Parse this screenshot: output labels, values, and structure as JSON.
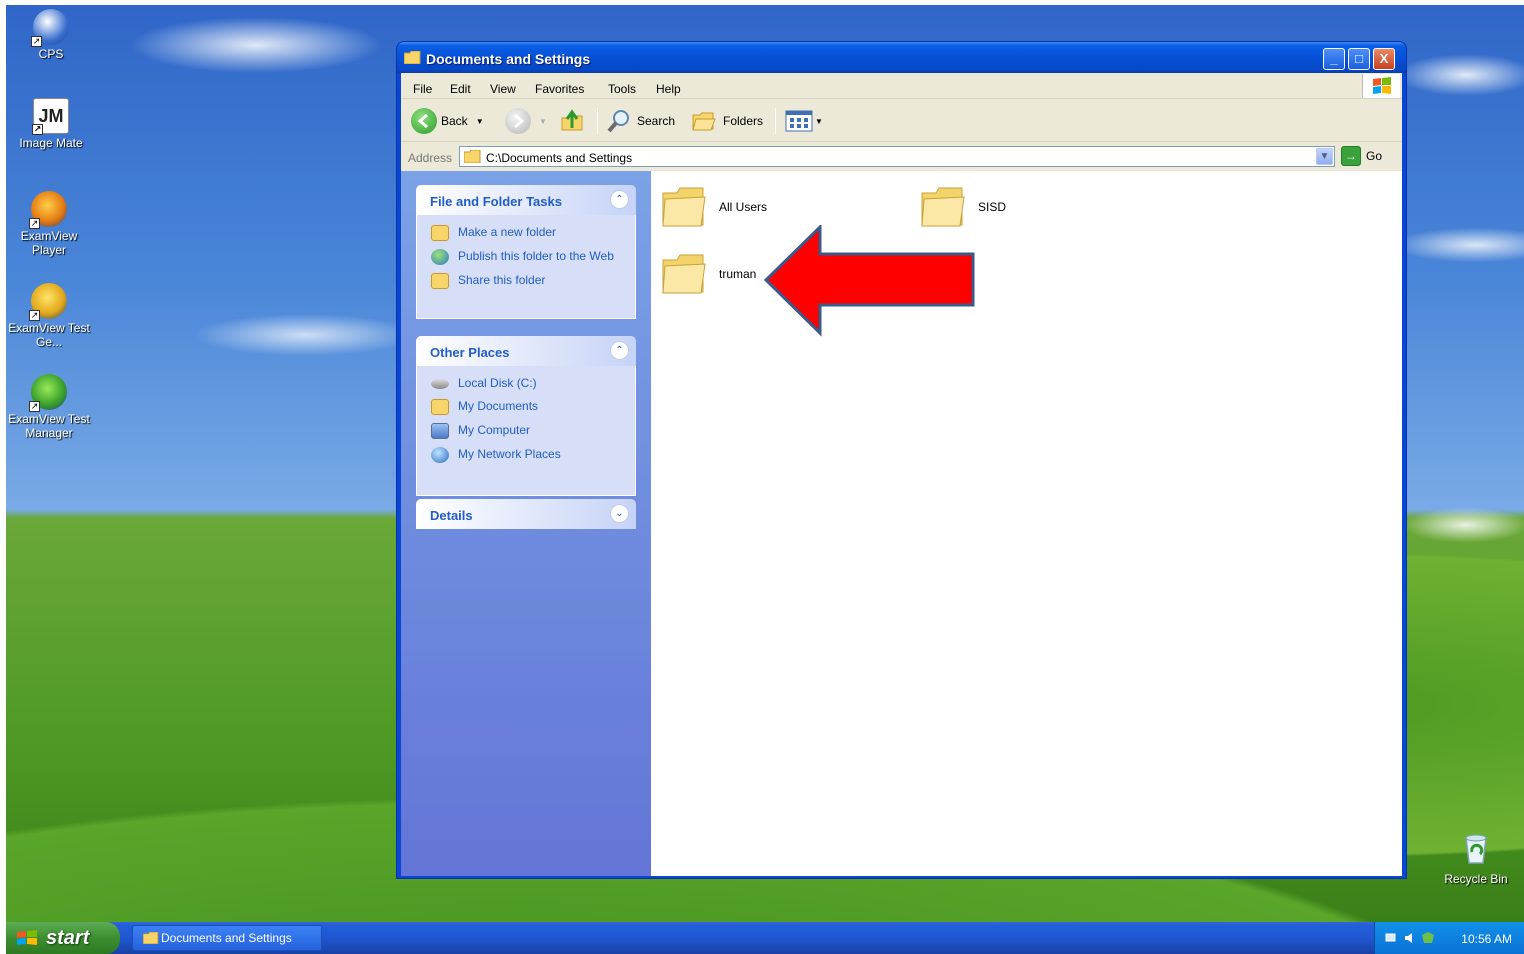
{
  "desktop": {
    "icons": [
      {
        "label": "CPS"
      },
      {
        "label": "Image Mate"
      },
      {
        "label": "ExamView Player"
      },
      {
        "label": "ExamView Test Ge..."
      },
      {
        "label": "ExamView Test Manager"
      }
    ],
    "recycle_bin": {
      "label": "Recycle Bin"
    }
  },
  "window": {
    "title": "Documents and Settings",
    "controls": {
      "minimize": "_",
      "maximize": "□",
      "close": "X"
    },
    "menu": [
      "File",
      "Edit",
      "View",
      "Favorites",
      "Tools",
      "Help"
    ],
    "toolbar": {
      "back_label": "Back",
      "search_label": "Search",
      "folders_label": "Folders"
    },
    "address": {
      "label": "Address",
      "value": "C:\\Documents and Settings",
      "go_label": "Go"
    },
    "task_pane": {
      "file_folder_tasks": {
        "title": "File and Folder Tasks",
        "items": [
          "Make a new folder",
          "Publish this folder to the Web",
          "Share this folder"
        ]
      },
      "other_places": {
        "title": "Other Places",
        "items": [
          "Local Disk (C:)",
          "My Documents",
          "My Computer",
          "My Network Places"
        ]
      },
      "details": {
        "title": "Details"
      }
    },
    "folders": [
      {
        "name": "All Users"
      },
      {
        "name": "SISD"
      },
      {
        "name": "truman"
      }
    ]
  },
  "taskbar": {
    "start_label": "start",
    "task_item": "Documents and Settings",
    "clock": "10:56 AM"
  },
  "colors": {
    "annotation_arrow": "#ff0000",
    "annotation_arrow_border": "#3a5a8a"
  }
}
